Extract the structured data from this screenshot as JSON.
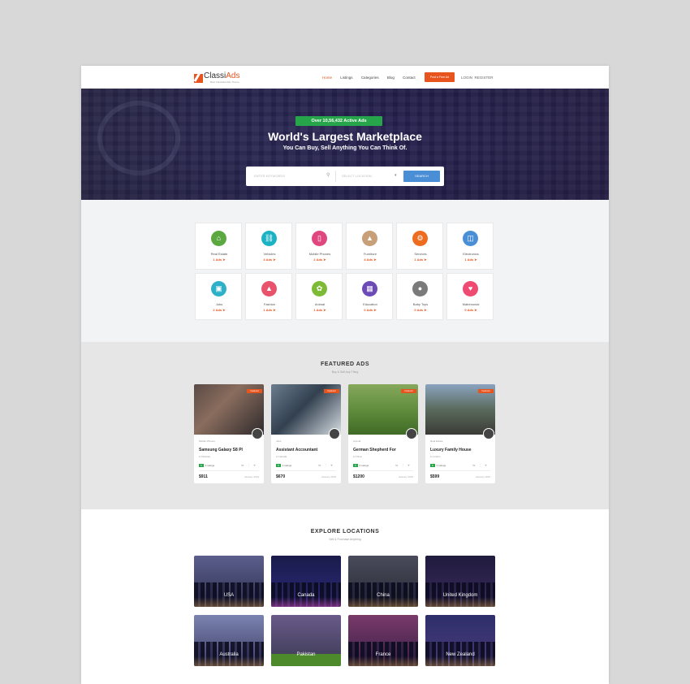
{
  "header": {
    "logo_prefix": "Classi",
    "logo_suffix": "Ads",
    "tagline": "Best Classified Ads Theme",
    "nav": [
      "Home",
      "Listings",
      "Categories",
      "Blog",
      "Contact"
    ],
    "post_button": "Post a Free Ad",
    "login": "LOGIN",
    "register": "REGISTER"
  },
  "hero": {
    "badge": "Over 10,56,432 Active Ads",
    "title": "World's Largest Marketplace",
    "subtitle": "You Can Buy, Sell Anything You Can Think Of.",
    "search_placeholder": "ENTER KEYWORDS",
    "location_placeholder": "SELECT LOCATION",
    "search_button": "SEARCH"
  },
  "categories": [
    {
      "name": "Real Estate",
      "count": "1 Ads",
      "icon": "home-icon",
      "color": "#5aa83f"
    },
    {
      "name": "Vehicles",
      "count": "4 Ads",
      "icon": "car-icon",
      "color": "#1bb2c4"
    },
    {
      "name": "Mobile Phones",
      "count": "2 Ads",
      "icon": "phone-icon",
      "color": "#e0477f"
    },
    {
      "name": "Furniture",
      "count": "4 Ads",
      "icon": "lamp-icon",
      "color": "#c79f78"
    },
    {
      "name": "Services",
      "count": "1 Ads",
      "icon": "gear-icon",
      "color": "#ee6c1f"
    },
    {
      "name": "Electronics",
      "count": "1 Ads",
      "icon": "monitor-icon",
      "color": "#4a8fd6"
    },
    {
      "name": "Jobs",
      "count": "2 Ads",
      "icon": "briefcase-icon",
      "color": "#2fb0c9"
    },
    {
      "name": "Fashion",
      "count": "1 Ads",
      "icon": "shirt-icon",
      "color": "#e8536b"
    },
    {
      "name": "Animal",
      "count": "1 Ads",
      "icon": "paw-icon",
      "color": "#7dbb36"
    },
    {
      "name": "Education",
      "count": "0 Ads",
      "icon": "book-icon",
      "color": "#6d4bb7"
    },
    {
      "name": "Baby Toys",
      "count": "0 Ads",
      "icon": "duck-icon",
      "color": "#7a7a7a"
    },
    {
      "name": "Matrimonial",
      "count": "0 Ads",
      "icon": "heart-icon",
      "color": "#ee4a72"
    }
  ],
  "featured": {
    "title": "FEATURED ADS",
    "subtitle": "Buy & Sell Any Thing",
    "ribbon": "Featured",
    "ads": [
      {
        "category": "Mobile Phones",
        "title": "Samsung Galaxy S8 Pl",
        "location": "Pakistan",
        "rating": "5",
        "ratings_label": "0 ratings",
        "price": "$911",
        "date": "January 2019"
      },
      {
        "category": "Jobs",
        "title": "Assistant Accountant",
        "location": "Canada",
        "rating": "5",
        "ratings_label": "0 ratings",
        "price": "$670",
        "date": "January 2019"
      },
      {
        "category": "Animal",
        "title": "German Shepherd For",
        "location": "China",
        "rating": "5",
        "ratings_label": "0 ratings",
        "price": "$1200",
        "date": "January 2019"
      },
      {
        "category": "Real Estate",
        "title": "Luxury Family House",
        "location": "London",
        "rating": "5",
        "ratings_label": "0 ratings",
        "price": "$599",
        "date": "January 2019"
      }
    ]
  },
  "locations": {
    "title": "EXPLORE LOCATIONS",
    "subtitle": "Sell & Purchase Anything",
    "items": [
      "USA",
      "Canada",
      "China",
      "United Kingdom",
      "Australia",
      "Pakistan",
      "France",
      "New Zealand"
    ]
  }
}
